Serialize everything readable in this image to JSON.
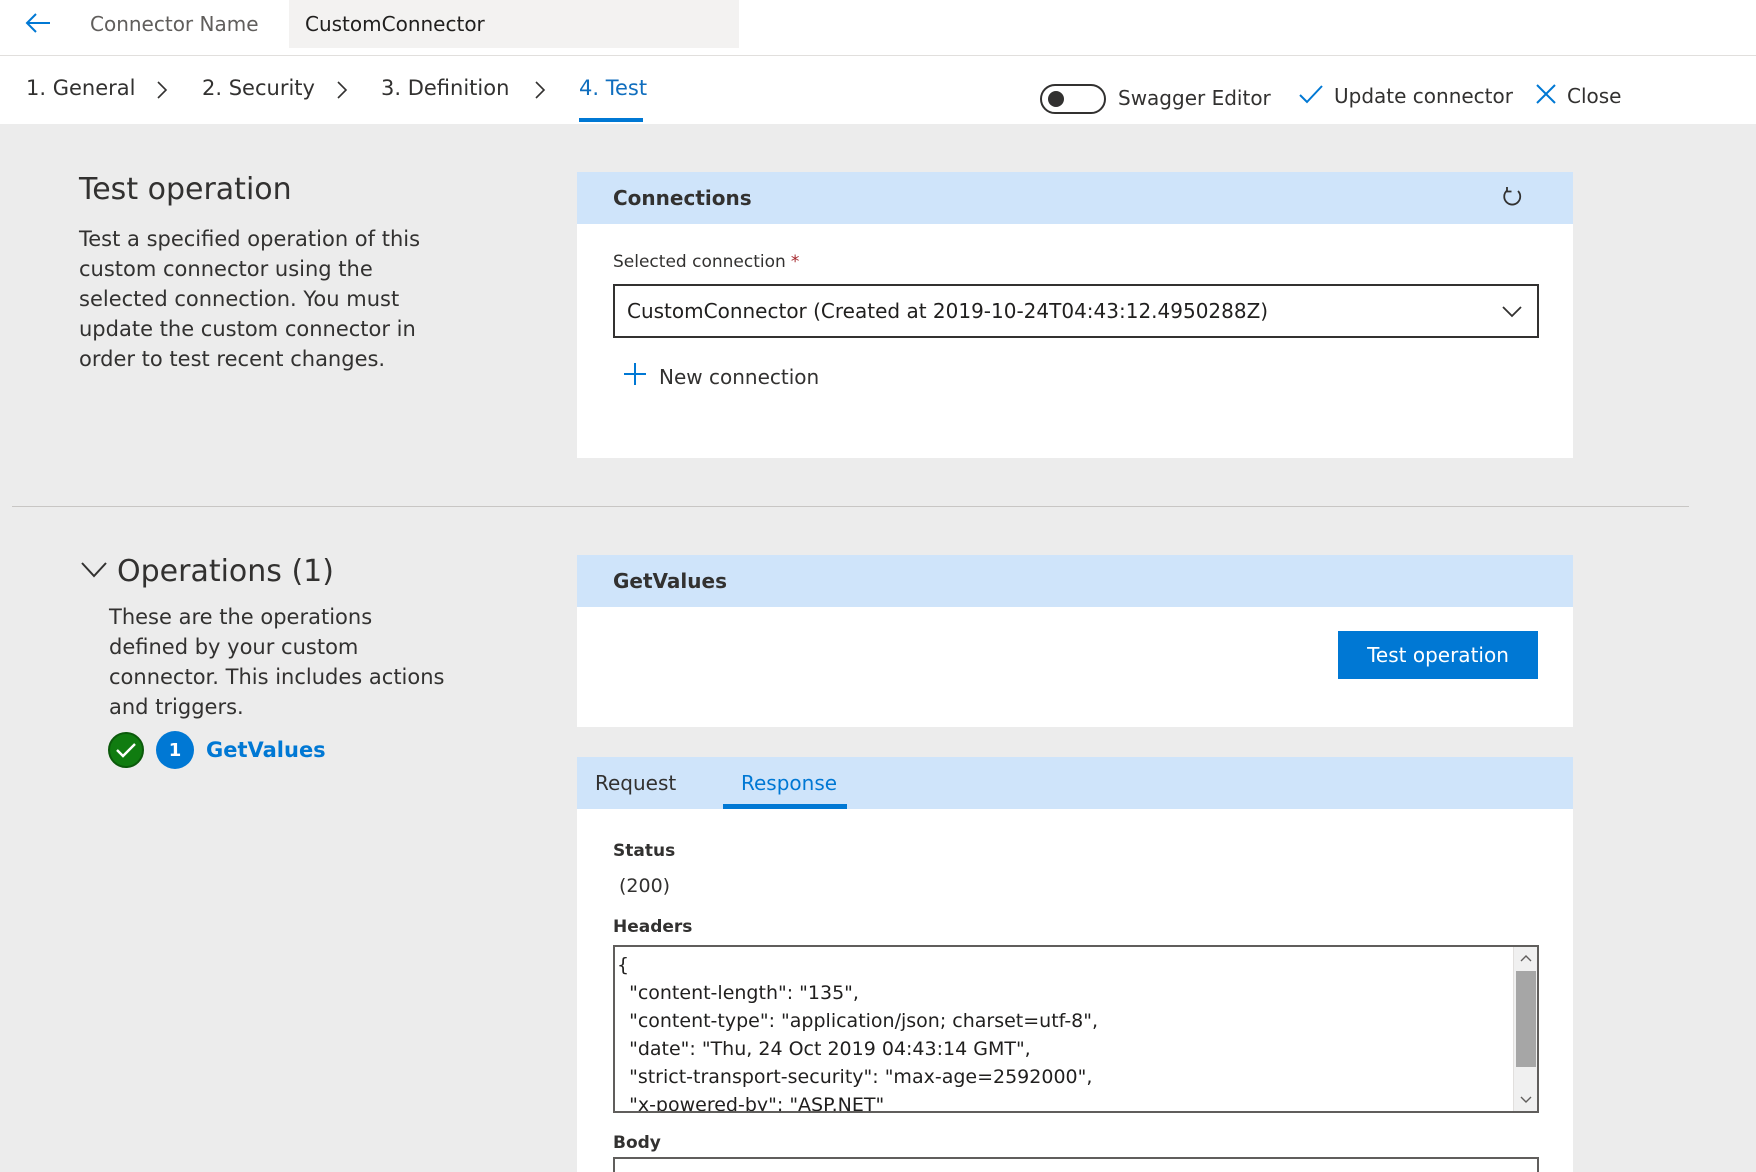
{
  "topbar": {
    "connector_name_label": "Connector Name",
    "connector_name_value": "CustomConnector"
  },
  "steps": [
    {
      "label": "1. General"
    },
    {
      "label": "2. Security"
    },
    {
      "label": "3. Definition"
    },
    {
      "label": "4. Test",
      "active": true
    }
  ],
  "commands": {
    "swagger_label": "Swagger Editor",
    "update_label": "Update connector",
    "close_label": "Close"
  },
  "test_section": {
    "title": "Test operation",
    "description_lines": [
      "Test a specified operation of this",
      "custom connector using the",
      "selected connection. You must",
      "update the custom connector in",
      "order to test recent changes."
    ]
  },
  "connections": {
    "title": "Connections",
    "selected_label": "Selected connection",
    "required_mark": "*",
    "selected_value": "CustomConnector (Created at 2019-10-24T04:43:12.4950288Z)",
    "new_connection_label": "New connection"
  },
  "operations": {
    "title": "Operations (1)",
    "description_lines": [
      "These are the operations",
      "defined by your custom",
      "connector. This includes actions",
      "and triggers."
    ],
    "items": [
      {
        "number": "1",
        "name": "GetValues"
      }
    ]
  },
  "operation_panel": {
    "title": "GetValues",
    "test_button_label": "Test operation"
  },
  "response_panel": {
    "tabs": [
      {
        "label": "Request"
      },
      {
        "label": "Response",
        "active": true
      }
    ],
    "status_label": "Status",
    "status_value": "(200)",
    "headers_label": "Headers",
    "headers_text": "{\n  \"content-length\": \"135\",\n  \"content-type\": \"application/json; charset=utf-8\",\n  \"date\": \"Thu, 24 Oct 2019 04:43:14 GMT\",\n  \"strict-transport-security\": \"max-age=2592000\",\n  \"x-powered-by\": \"ASP.NET\"",
    "body_label": "Body"
  },
  "colors": {
    "accent": "#0078d4",
    "panel_header": "#cfe4fa",
    "success": "#107c10",
    "background": "#ececec"
  }
}
